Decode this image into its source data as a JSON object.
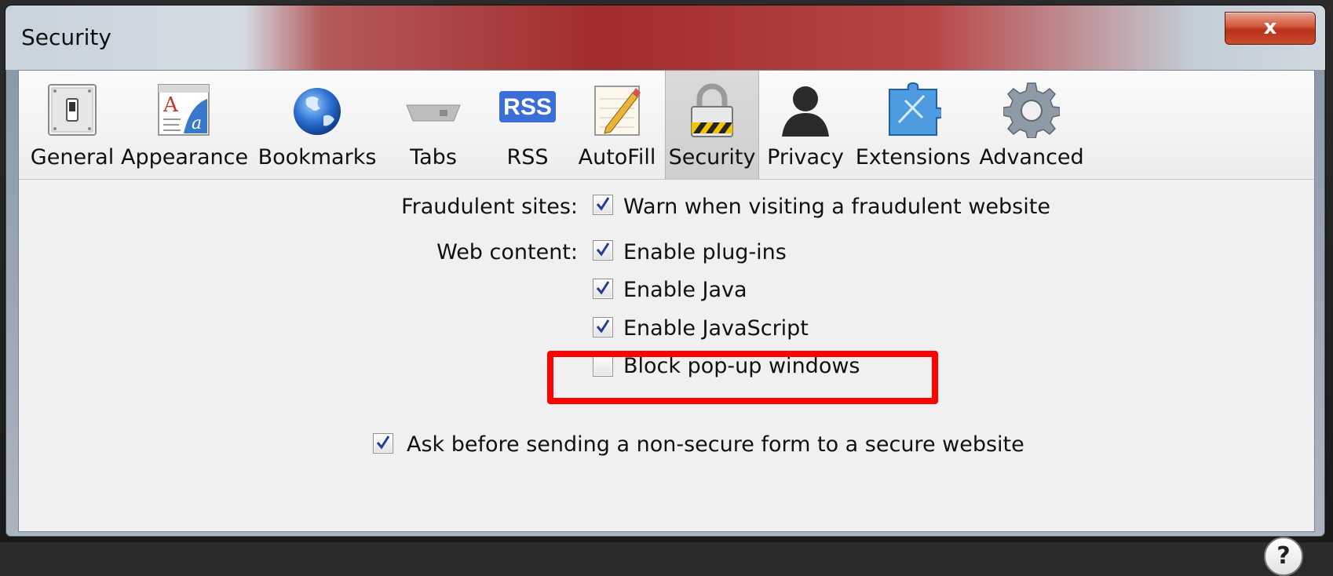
{
  "window": {
    "title": "Security",
    "close_glyph": "x"
  },
  "toolbar": {
    "items": [
      {
        "label": "General",
        "icon": "general-switch-icon"
      },
      {
        "label": "Appearance",
        "icon": "appearance-font-icon"
      },
      {
        "label": "Bookmarks",
        "icon": "bookmarks-globe-icon"
      },
      {
        "label": "Tabs",
        "icon": "tabs-icon"
      },
      {
        "label": "RSS",
        "icon": "rss-icon",
        "badge": "RSS"
      },
      {
        "label": "AutoFill",
        "icon": "autofill-pencil-icon"
      },
      {
        "label": "Security",
        "icon": "security-lock-icon",
        "selected": true
      },
      {
        "label": "Privacy",
        "icon": "privacy-person-icon"
      },
      {
        "label": "Extensions",
        "icon": "extensions-puzzle-icon"
      },
      {
        "label": "Advanced",
        "icon": "advanced-gear-icon"
      }
    ]
  },
  "settings": {
    "fraudulent_label": "Fraudulent sites:",
    "fraudulent_option": {
      "label": "Warn when visiting a fraudulent website",
      "checked": true
    },
    "web_content_label": "Web content:",
    "web_options": [
      {
        "label": "Enable plug-ins",
        "checked": true
      },
      {
        "label": "Enable Java",
        "checked": true
      },
      {
        "label": "Enable JavaScript",
        "checked": true
      },
      {
        "label": "Block pop-up windows",
        "checked": false
      }
    ],
    "nonsecure_form": {
      "label": "Ask before sending a non-secure form to a secure website",
      "checked": true
    }
  },
  "help": {
    "glyph": "?"
  },
  "colors": {
    "highlight": "#ff0000",
    "checkmark": "#1f3f8f"
  }
}
